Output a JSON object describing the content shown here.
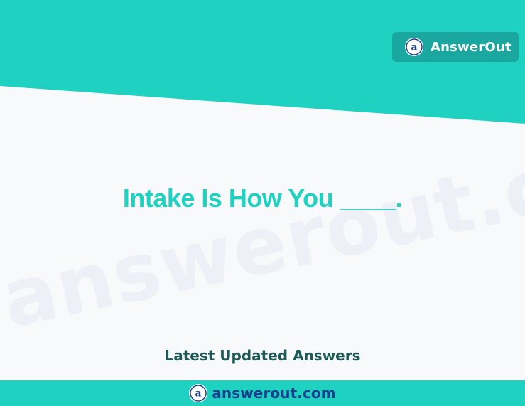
{
  "colors": {
    "accent_teal": "#1ed1c1",
    "badge_teal": "#1aa79f",
    "page_background": "#f8f9fb",
    "heading_dark_green": "#1d5a57",
    "brand_blue": "#1a3f8f",
    "white": "#ffffff"
  },
  "header": {
    "brand_label": "AnswerOut",
    "logo_icon": "answerout-a-logo-icon"
  },
  "watermark": {
    "text": "answerout.com"
  },
  "main": {
    "question": "Intake Is How You ____."
  },
  "section": {
    "latest_label": "Latest Updated Answers"
  },
  "footer": {
    "domain": "answerout.com",
    "logo_icon": "answerout-a-logo-icon"
  }
}
